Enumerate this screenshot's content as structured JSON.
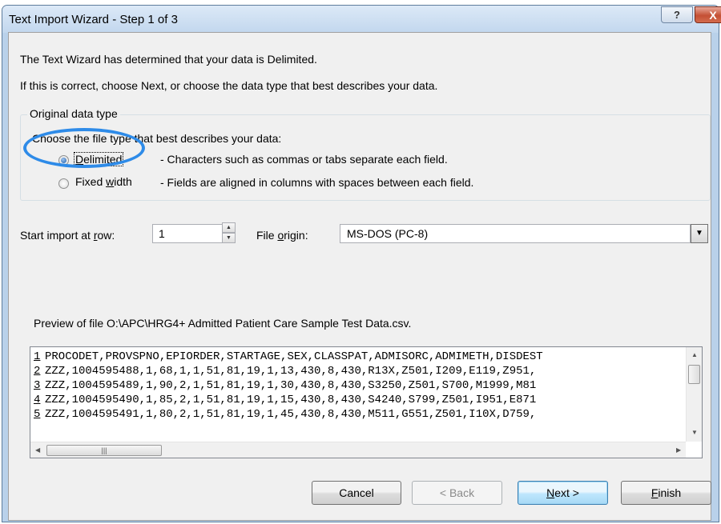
{
  "window": {
    "title": "Text Import Wizard - Step 1 of 3",
    "help_label": "?",
    "close_label": "X"
  },
  "intro": {
    "line1": "The Text Wizard has determined that your data is Delimited.",
    "line2": "If this is correct, choose Next, or choose the data type that best describes your data."
  },
  "data_type": {
    "group_label": "Original data type",
    "prompt": "Choose the file type that best describes your data:",
    "options": [
      {
        "label": "Delimited",
        "description": "- Characters such as commas or tabs separate each field.",
        "selected": true
      },
      {
        "label": "Fixed width",
        "description": "- Fields are aligned in columns with spaces between each field.",
        "selected": false
      }
    ]
  },
  "start_row": {
    "label": "Start import at row:",
    "value": "1"
  },
  "file_origin": {
    "label": "File origin:",
    "value": "MS-DOS (PC-8)"
  },
  "preview": {
    "label": "Preview of file O:\\APC\\HRG4+ Admitted Patient Care Sample Test Data.csv.",
    "rows": [
      {
        "num": "1",
        "text": "PROCODET,PROVSPNO,EPIORDER,STARTAGE,SEX,CLASSPAT,ADMISORC,ADMIMETH,DISDEST"
      },
      {
        "num": "2",
        "text": "ZZZ,1004595488,1,68,1,1,51,81,19,1,13,430,8,430,R13X,Z501,I209,E119,Z951,"
      },
      {
        "num": "3",
        "text": "ZZZ,1004595489,1,90,2,1,51,81,19,1,30,430,8,430,S3250,Z501,S700,M1999,M81"
      },
      {
        "num": "4",
        "text": "ZZZ,1004595490,1,85,2,1,51,81,19,1,15,430,8,430,S4240,S799,Z501,I951,E871"
      },
      {
        "num": "5",
        "text": "ZZZ,1004595491,1,80,2,1,51,81,19,1,45,430,8,430,M511,G551,Z501,I10X,D759,"
      }
    ]
  },
  "buttons": {
    "cancel": "Cancel",
    "back": "< Back",
    "next": "Next >",
    "finish": "Finish"
  },
  "colors": {
    "highlight": "#2e8be8",
    "title_bar": "#c2d7ee",
    "close_button": "#c45034"
  }
}
